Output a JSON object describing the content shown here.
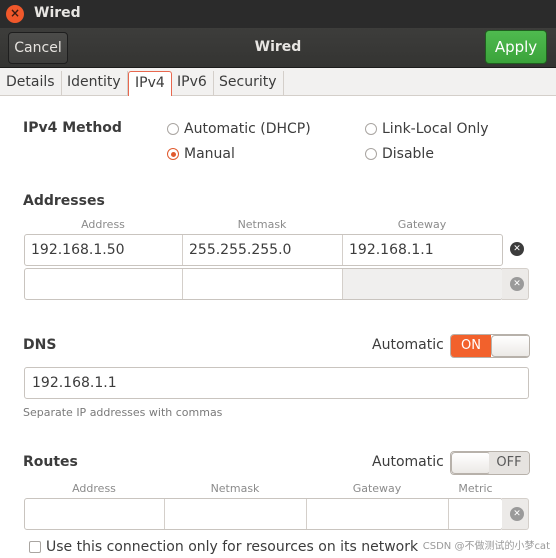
{
  "titlebar": {
    "close_glyph": "×",
    "title": "Wired"
  },
  "header": {
    "cancel_label": "Cancel",
    "title": "Wired",
    "apply_label": "Apply"
  },
  "tabs": [
    {
      "label": "Details"
    },
    {
      "label": "Identity"
    },
    {
      "label": "IPv4"
    },
    {
      "label": "IPv6"
    },
    {
      "label": "Security"
    }
  ],
  "active_tab": "IPv4",
  "ipv4": {
    "method_label": "IPv4 Method",
    "options": [
      {
        "label": "Automatic (DHCP)",
        "selected": false
      },
      {
        "label": "Link-Local Only",
        "selected": false
      },
      {
        "label": "Manual",
        "selected": true
      },
      {
        "label": "Disable",
        "selected": false
      }
    ]
  },
  "addresses": {
    "title": "Addresses",
    "columns": [
      "Address",
      "Netmask",
      "Gateway"
    ],
    "rows": [
      [
        "192.168.1.50",
        "255.255.255.0",
        "192.168.1.1"
      ],
      [
        "",
        "",
        ""
      ]
    ]
  },
  "dns": {
    "title": "DNS",
    "automatic_label": "Automatic",
    "switch_label": "ON",
    "switch_on": true,
    "value": "192.168.1.1",
    "hint": "Separate IP addresses with commas"
  },
  "routes": {
    "title": "Routes",
    "automatic_label": "Automatic",
    "switch_label": "OFF",
    "switch_on": false,
    "columns": [
      "Address",
      "Netmask",
      "Gateway",
      "Metric"
    ]
  },
  "only_local": {
    "label": "Use this connection only for resources on its network",
    "checked": false
  },
  "watermark": "CSDN @不做测试的小梦cat",
  "colors": {
    "accent": "#f2612c",
    "apply": "#3aa33a",
    "titlebar": "#2b2b2b"
  }
}
